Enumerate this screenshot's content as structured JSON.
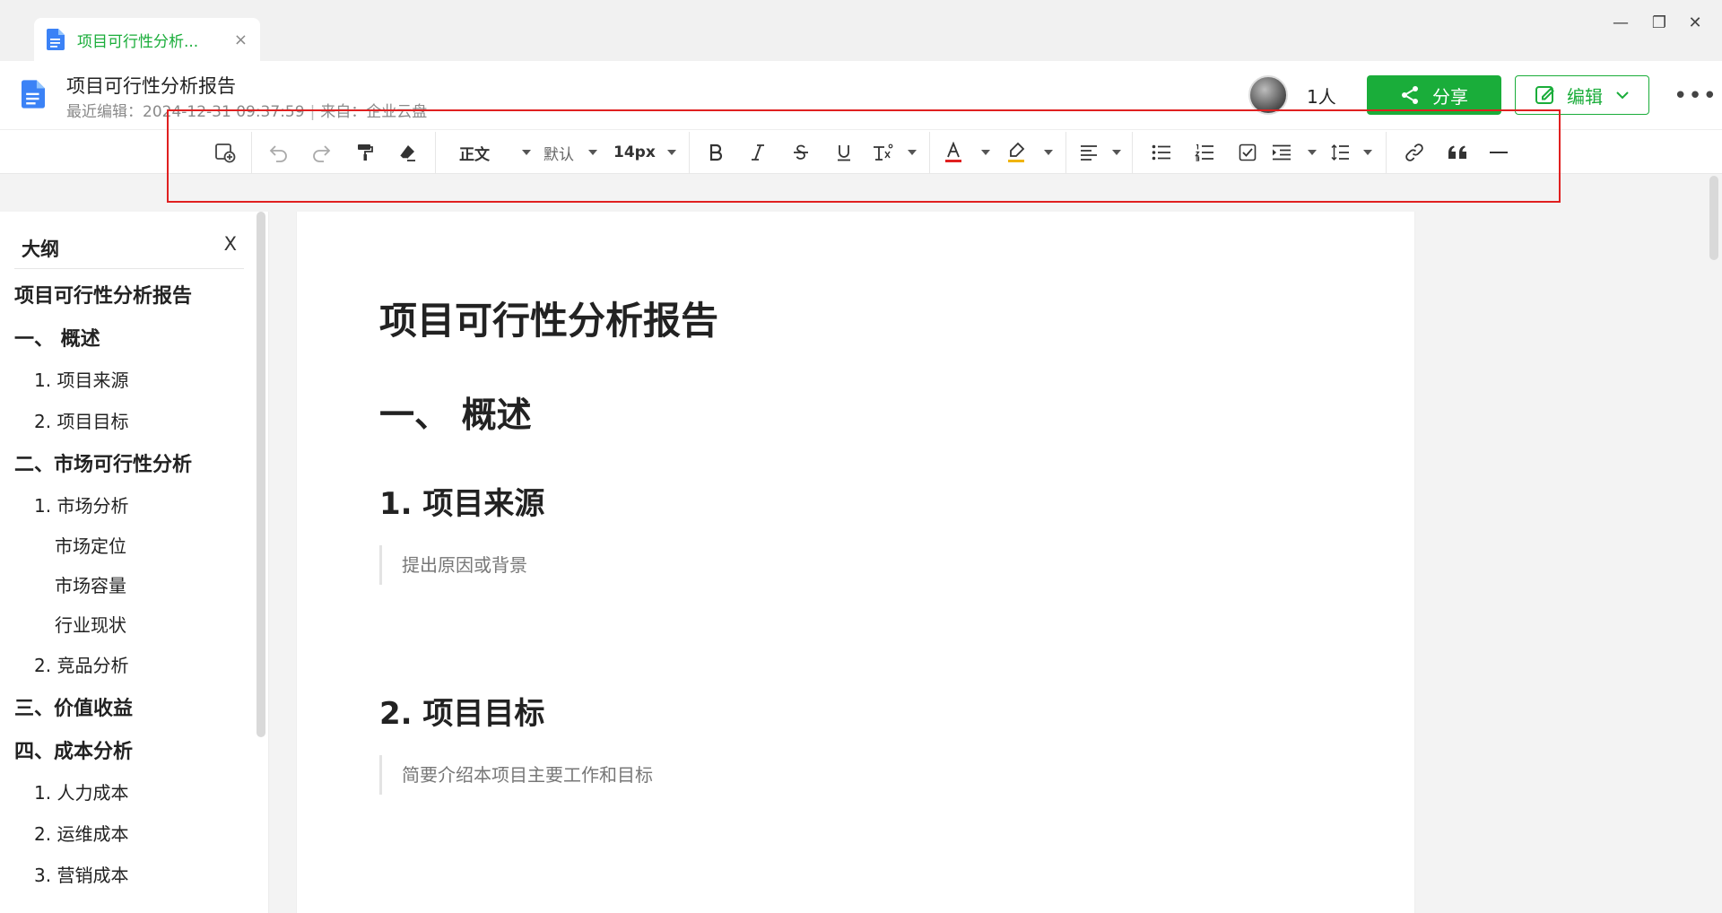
{
  "tab": {
    "label": "项目可行性分析...",
    "close": "×"
  },
  "window": {
    "minimize": "—",
    "restore": "❐",
    "close": "✕"
  },
  "header": {
    "title": "项目可行性分析报告",
    "meta_edited_label": "最近编辑：",
    "meta_edited_time": "2024-12-31 09:37:59",
    "meta_sep": "|",
    "meta_source": "来自：企业云盘",
    "users_count": "1人",
    "share_label": "分享",
    "edit_label": "编辑",
    "more": "•••"
  },
  "toolbar": {
    "style_value": "正文",
    "font_value": "默认",
    "size_value": "14px",
    "text_color": "#e02020",
    "highlight_color": "#f0b400",
    "icons": [
      "insert-icon",
      "undo-icon",
      "redo-icon",
      "format-painter-icon",
      "eraser-icon",
      "bold-icon",
      "italic-icon",
      "strikethrough-icon",
      "underline-icon",
      "superscript-icon",
      "font-color-icon",
      "highlight-icon",
      "align-icon",
      "bullet-list-icon",
      "numbered-list-icon",
      "checklist-icon",
      "indent-icon",
      "line-spacing-icon",
      "link-icon",
      "quote-icon",
      "divider-icon"
    ]
  },
  "outline": {
    "title": "大纲",
    "close": "X",
    "items": [
      {
        "level": 1,
        "label": "项目可行性分析报告"
      },
      {
        "level": 1,
        "label": "一、 概述"
      },
      {
        "level": 2,
        "label": "1. 项目来源"
      },
      {
        "level": 2,
        "label": "2. 项目目标"
      },
      {
        "level": 1,
        "label": "二、市场可行性分析"
      },
      {
        "level": 2,
        "label": "1. 市场分析"
      },
      {
        "level": 3,
        "label": "市场定位"
      },
      {
        "level": 3,
        "label": "市场容量"
      },
      {
        "level": 3,
        "label": "行业现状"
      },
      {
        "level": 2,
        "label": "2. 竞品分析"
      },
      {
        "level": 1,
        "label": "三、价值收益"
      },
      {
        "level": 1,
        "label": "四、成本分析"
      },
      {
        "level": 2,
        "label": "1. 人力成本"
      },
      {
        "level": 2,
        "label": "2. 运维成本"
      },
      {
        "level": 2,
        "label": "3. 营销成本"
      }
    ]
  },
  "document": {
    "title": "项目可行性分析报告",
    "section1": "一、 概述",
    "sub1": "1. 项目来源",
    "sub1_text": "提出原因或背景",
    "sub2": "2. 项目目标",
    "sub2_text": "简要介绍本项目主要工作和目标"
  },
  "colors": {
    "accent": "#1aad3a",
    "highlight_box": "#e02020"
  }
}
